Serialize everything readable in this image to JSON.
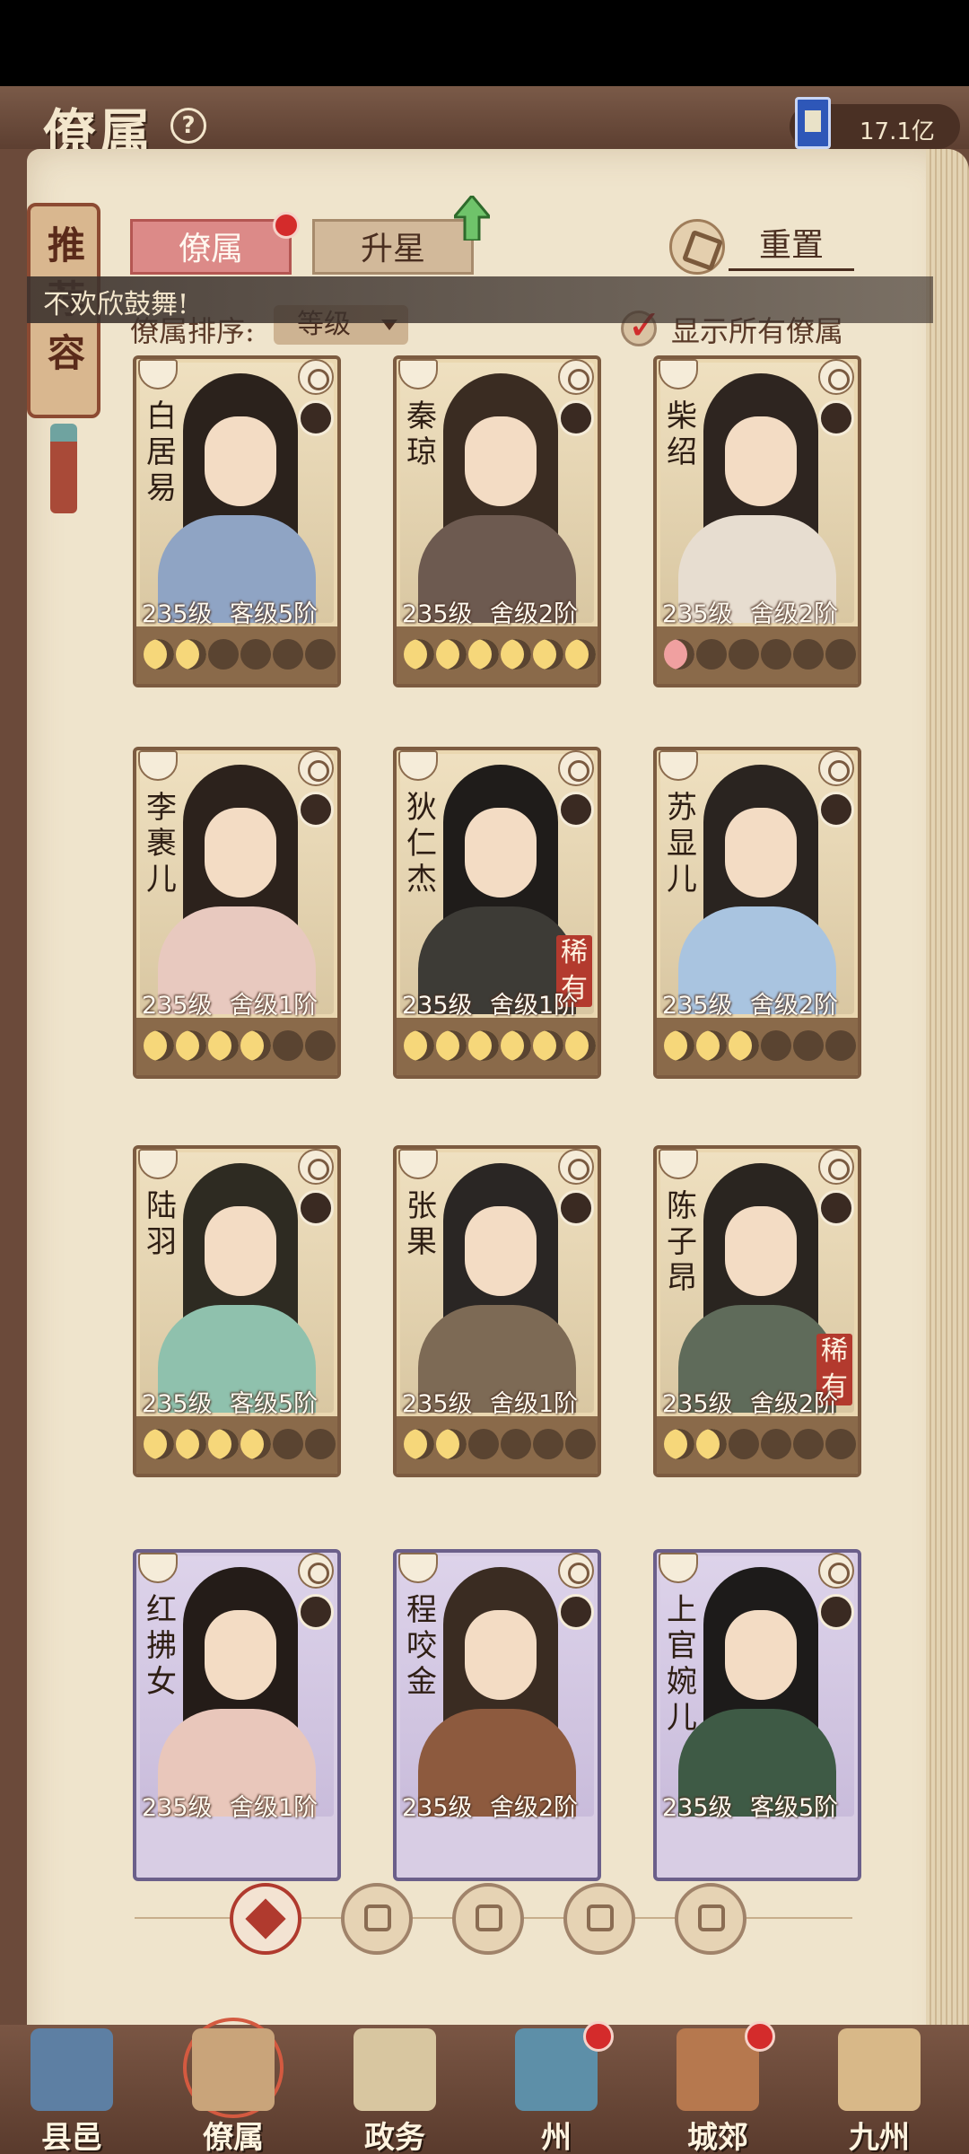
{
  "header": {
    "title": "僚属",
    "currency_value": "17.1亿"
  },
  "recommend": {
    "chars": [
      "推",
      "荐",
      "容"
    ]
  },
  "tabs": [
    {
      "label": "僚属",
      "active": true
    },
    {
      "label": "升星",
      "active": false
    }
  ],
  "reset_label": "重置",
  "toast": "不欢欣鼓舞!",
  "sort": {
    "label": "僚属排序:",
    "value": "等级"
  },
  "show_all": {
    "label": "显示所有僚属",
    "checked": true
  },
  "colors": {
    "accent_red": "#b33a2e",
    "tab_active": "#dc8a88",
    "moon_gold": "#f6d77a"
  },
  "cards": [
    {
      "name": [
        "白",
        "居",
        "易"
      ],
      "level": "235级",
      "rank": "客级5阶",
      "moons": [
        1,
        1,
        0,
        0,
        0,
        0
      ],
      "rare": "",
      "theme": "tan",
      "hair": "#2b221c",
      "robe": "#8fa4c4"
    },
    {
      "name": [
        "秦",
        "琼"
      ],
      "level": "235级",
      "rank": "舍级2阶",
      "moons": [
        1,
        1,
        1,
        1,
        1,
        1
      ],
      "rare": "",
      "theme": "tan",
      "hair": "#3a2c22",
      "robe": "#6d5a50"
    },
    {
      "name": [
        "柴",
        "绍"
      ],
      "level": "235级",
      "rank": "舍级2阶",
      "moons": [
        2,
        0,
        0,
        0,
        0,
        0
      ],
      "rare": "",
      "theme": "tan",
      "hair": "#2e2520",
      "robe": "#e7ddd0"
    },
    {
      "name": [
        "李",
        "裹",
        "儿"
      ],
      "level": "235级",
      "rank": "舍级1阶",
      "moons": [
        1,
        1,
        1,
        1,
        0,
        0
      ],
      "rare": "",
      "theme": "tan",
      "hair": "#2c221c",
      "robe": "#e8c9bf"
    },
    {
      "name": [
        "狄",
        "仁",
        "杰"
      ],
      "level": "235级",
      "rank": "舍级1阶",
      "moons": [
        1,
        1,
        1,
        1,
        1,
        1
      ],
      "rare": "稀有",
      "theme": "tan",
      "hair": "#1f1c1a",
      "robe": "#3d3b36"
    },
    {
      "name": [
        "苏",
        "显",
        "儿"
      ],
      "level": "235级",
      "rank": "舍级2阶",
      "moons": [
        1,
        1,
        1,
        0,
        0,
        0
      ],
      "rare": "",
      "theme": "tan",
      "hair": "#2a2420",
      "robe": "#a9c4e0"
    },
    {
      "name": [
        "陆",
        "羽"
      ],
      "level": "235级",
      "rank": "客级5阶",
      "moons": [
        1,
        1,
        1,
        1,
        0,
        0
      ],
      "rare": "",
      "theme": "tan",
      "hair": "#2e2b22",
      "robe": "#8fc1ad"
    },
    {
      "name": [
        "张",
        "果"
      ],
      "level": "235级",
      "rank": "舍级1阶",
      "moons": [
        1,
        1,
        0,
        0,
        0,
        0
      ],
      "rare": "",
      "theme": "tan",
      "hair": "#2a2624",
      "robe": "#7d6a55"
    },
    {
      "name": [
        "陈",
        "子",
        "昂"
      ],
      "level": "235级",
      "rank": "舍级2阶",
      "moons": [
        1,
        1,
        0,
        0,
        0,
        0
      ],
      "rare": "稀有",
      "theme": "tan",
      "hair": "#2a2520",
      "robe": "#5f6b5a"
    },
    {
      "name": [
        "红",
        "拂",
        "女"
      ],
      "level": "235级",
      "rank": "舍级1阶",
      "moons": [],
      "rare": "",
      "theme": "purple",
      "hair": "#241c18",
      "robe": "#e9c7bb"
    },
    {
      "name": [
        "程",
        "咬",
        "金"
      ],
      "level": "235级",
      "rank": "舍级2阶",
      "moons": [],
      "rare": "",
      "theme": "purple",
      "hair": "#3a2c22",
      "robe": "#8d5a3e"
    },
    {
      "name": [
        "上",
        "官",
        "婉",
        "儿"
      ],
      "level": "235级",
      "rank": "客级5阶",
      "moons": [],
      "rare": "",
      "theme": "purple",
      "hair": "#1d1b1a",
      "robe": "#3e5a45"
    }
  ],
  "filters": [
    "all-icon",
    "scholar-hat-icon",
    "monkey-icon",
    "fan-icon",
    "horse-icon"
  ],
  "nav": [
    {
      "label": "县邑",
      "icon": "county-icon",
      "dot": false,
      "active": false
    },
    {
      "label": "僚属",
      "icon": "retainer-icon",
      "dot": false,
      "active": true
    },
    {
      "label": "政务",
      "icon": "affairs-icon",
      "dot": false,
      "active": false
    },
    {
      "label": "州",
      "icon": "prefecture-icon",
      "dot": true,
      "active": false
    },
    {
      "label": "城郊",
      "icon": "suburb-icon",
      "dot": true,
      "active": false
    },
    {
      "label": "九州",
      "icon": "map-icon",
      "dot": false,
      "active": false
    }
  ]
}
